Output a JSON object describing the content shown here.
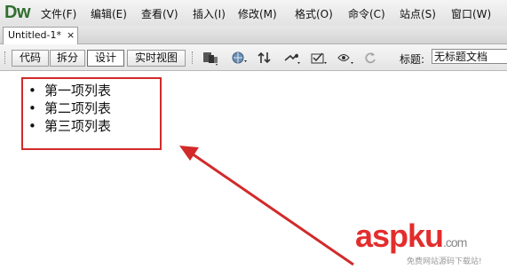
{
  "app": {
    "logo": "Dw"
  },
  "menu": [
    {
      "label": "文件(F)"
    },
    {
      "label": "编辑(E)"
    },
    {
      "label": "查看(V)"
    },
    {
      "label": "插入(I)"
    },
    {
      "label": "修改(M)"
    },
    {
      "label": "格式(O)"
    },
    {
      "label": "命令(C)"
    },
    {
      "label": "站点(S)"
    },
    {
      "label": "窗口(W)"
    }
  ],
  "tab": {
    "name": "Untitled-1*",
    "close": "×"
  },
  "view_buttons": [
    {
      "label": "代码"
    },
    {
      "label": "拆分"
    },
    {
      "label": "设计",
      "active": true
    },
    {
      "label": "实时视图"
    }
  ],
  "toolbar_icons": [
    "multiscreen-icon",
    "preview-globe-icon",
    "file-transfer-icon",
    "debug-icon",
    "visual-aids-icon",
    "refresh-design-icon",
    "refresh-icon"
  ],
  "title_field": {
    "label": "标题:",
    "value": "无标题文档"
  },
  "document": {
    "list_items": [
      {
        "bullet": "•",
        "text": "第一项列表"
      },
      {
        "bullet": "•",
        "text": "第二项列表"
      },
      {
        "bullet": "•",
        "text": "第三项列表"
      }
    ]
  },
  "annotation": {
    "color": "#d22a2a"
  },
  "watermark": {
    "brand": "aspku",
    "domain": ".com",
    "sub": "免费网站源码下载站!"
  }
}
